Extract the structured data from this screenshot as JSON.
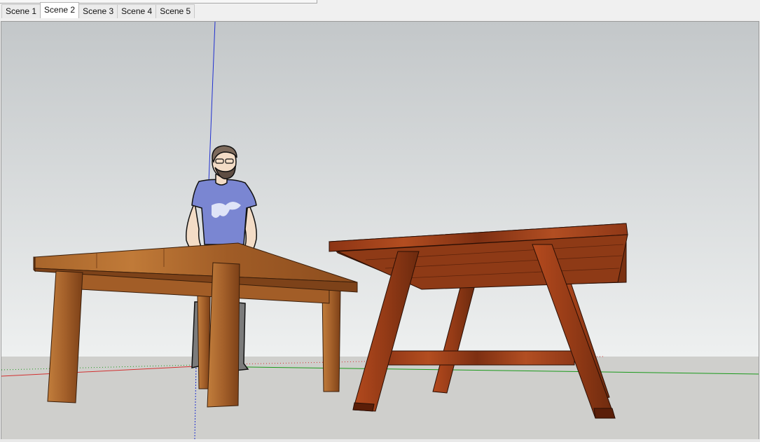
{
  "scenes": {
    "tabs": [
      {
        "label": "Scene 1"
      },
      {
        "label": "Scene 2"
      },
      {
        "label": "Scene 3"
      },
      {
        "label": "Scene 4"
      },
      {
        "label": "Scene 5"
      }
    ],
    "active_tab": "Scene 2"
  },
  "colors": {
    "sky_top": "#c3c7c9",
    "sky_bottom": "#eef0f0",
    "ground": "#cfcfcc",
    "wood_light": "#b06a2c",
    "wood_dark": "#6e3612",
    "wood_red": "#9e3e1a",
    "shirt": "#7a86d2",
    "axis_red": "#d23030",
    "axis_green": "#1a9a1a",
    "axis_blue": "#2030d0"
  }
}
